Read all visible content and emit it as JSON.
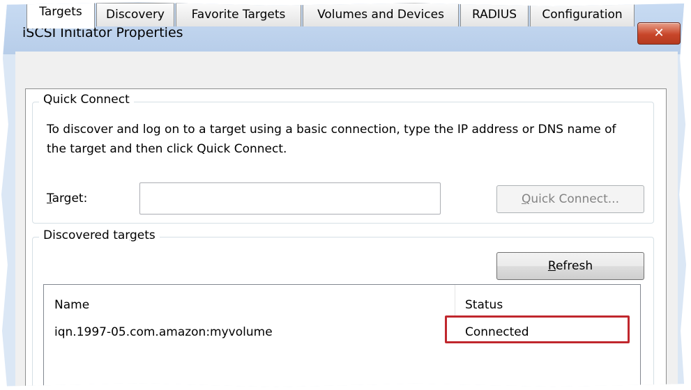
{
  "window": {
    "title": "iSCSI Initiator Properties",
    "close_glyph": "✕"
  },
  "tabs": [
    {
      "label": "Targets",
      "active": true
    },
    {
      "label": "Discovery",
      "active": false
    },
    {
      "label": "Favorite Targets",
      "active": false
    },
    {
      "label": "Volumes and Devices",
      "active": false
    },
    {
      "label": "RADIUS",
      "active": false
    },
    {
      "label": "Configuration",
      "active": false
    }
  ],
  "quick_connect": {
    "legend": "Quick Connect",
    "description": "To discover and log on to a target using a basic connection, type the IP address or DNS name of the target and then click Quick Connect.",
    "target_label_mnemonic": "T",
    "target_label_rest": "arget:",
    "target_value": "",
    "button_mnemonic": "Q",
    "button_rest": "uick Connect..."
  },
  "discovered_targets": {
    "legend_pre": "Discovered tar",
    "legend_mnemonic": "g",
    "legend_post": "ets",
    "refresh_mnemonic": "R",
    "refresh_rest": "efresh",
    "columns": [
      "Name",
      "Status"
    ],
    "rows": [
      {
        "name": "iqn.1997-05.com.amazon:myvolume",
        "status": "Connected"
      }
    ]
  },
  "colors": {
    "highlight": "#c0272d",
    "close_button": "#c8462a"
  }
}
